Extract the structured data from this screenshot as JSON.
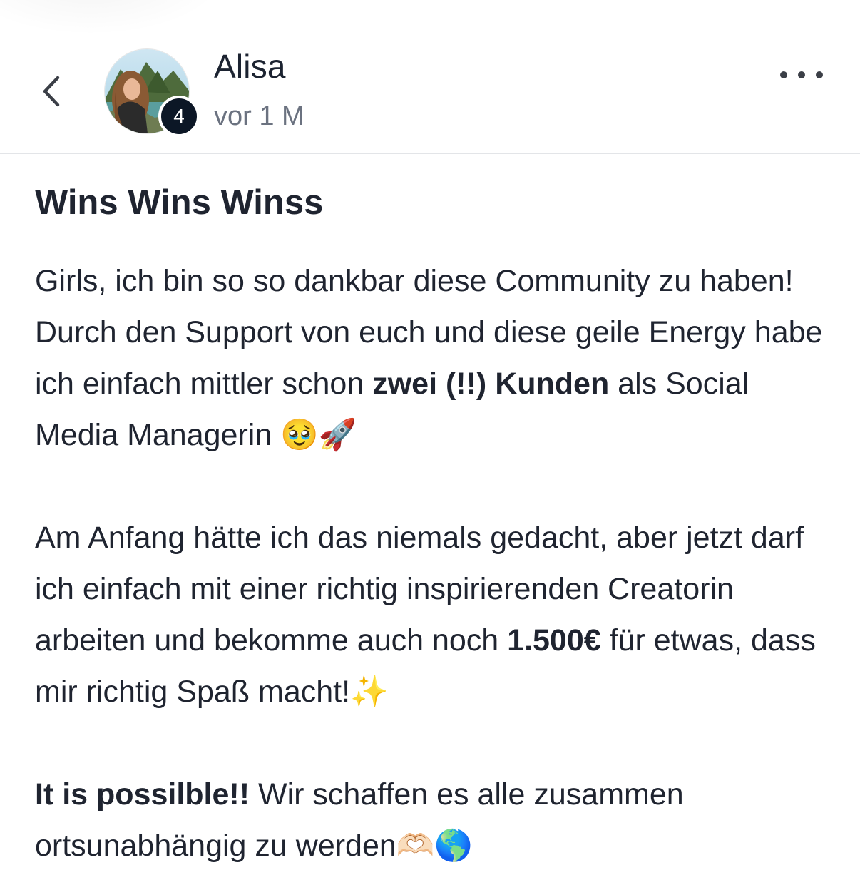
{
  "header": {
    "author_name": "Alisa",
    "level": "4",
    "time_ago": "vor 1 M"
  },
  "post": {
    "title": "Wins Wins Winss",
    "paragraphs": [
      [
        {
          "text": "Girls, ich bin so so dankbar diese Community zu haben! Durch den Support von euch und diese geile Energy habe ich einfach mittler schon "
        },
        {
          "text": "zwei (!!) Kunden",
          "bold": true
        },
        {
          "text": " als Social Media Managerin 🥹🚀"
        }
      ],
      [
        {
          "text": "Am Anfang hätte ich das niemals gedacht, aber jetzt darf ich einfach mit einer richtig inspirierenden Creatorin arbeiten und bekomme auch noch "
        },
        {
          "text": "1.500€",
          "bold": true
        },
        {
          "text": " für etwas, dass mir richtig Spaß macht!✨"
        }
      ],
      [
        {
          "text": "It is possilble!!",
          "bold": true
        },
        {
          "text": " Wir schaffen es alle zusammen ortsunabhängig zu werden🫶🏻🌎"
        }
      ]
    ]
  },
  "icons": {
    "back": "chevron-left-icon",
    "more": "more-horizontal-icon"
  },
  "colors": {
    "text": "#1f2430",
    "muted": "#6b7280",
    "badge": "#0c1726",
    "divider": "#e3e5e8"
  }
}
